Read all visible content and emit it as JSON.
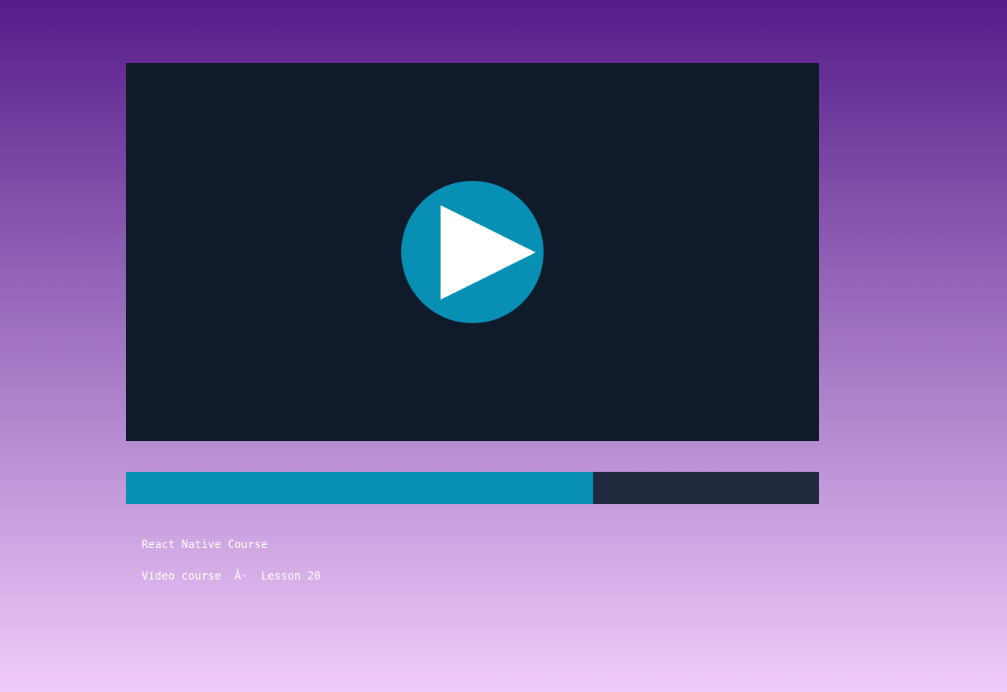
{
  "colors": {
    "accent": "#0890b4",
    "player_background": "#0f1a2b",
    "track_background": "#1f2a3f",
    "text": "#ffffff"
  },
  "player": {
    "play_icon": "play-icon",
    "progress_fraction": 0.674
  },
  "course": {
    "title": "React Native Course",
    "subtitle": "Video course  Â·  Lesson 20"
  }
}
